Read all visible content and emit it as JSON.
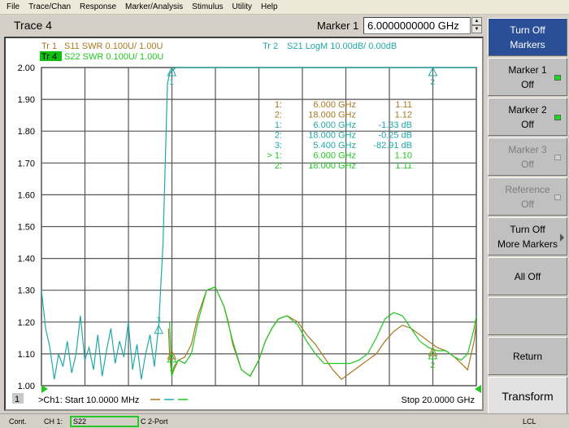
{
  "menu": [
    "File",
    "Trace/Chan",
    "Response",
    "Marker/Analysis",
    "Stimulus",
    "Utility",
    "Help"
  ],
  "toolbar": {
    "active_trace": "Trace 4",
    "marker_label": "Marker 1",
    "marker_value": "6.0000000000 GHz"
  },
  "traces": {
    "tr1": {
      "id": "Tr 1",
      "desc": "S11 SWR 0.100U/  1.00U",
      "color": "#a87820"
    },
    "tr2": {
      "id": "Tr 2",
      "desc": "S21 LogM 10.00dB/  0.00dB",
      "color": "#20a8a8"
    },
    "tr4": {
      "id": "Tr 4",
      "desc": "S22 SWR 0.100U/  1.00U",
      "color": "#20c820"
    }
  },
  "marker_table": [
    {
      "trace": "tr1",
      "num": "1:",
      "freq": "6.000 GHz",
      "value": "1.11"
    },
    {
      "trace": "tr1",
      "num": "2:",
      "freq": "18.000 GHz",
      "value": "1.12"
    },
    {
      "trace": "tr2",
      "num": "1:",
      "freq": "6.000 GHz",
      "value": "-1.33 dB"
    },
    {
      "trace": "tr2",
      "num": "2:",
      "freq": "18.000 GHz",
      "value": "-0.25 dB"
    },
    {
      "trace": "tr2",
      "num": "3:",
      "freq": "5.400 GHz",
      "value": "-82.91 dB"
    },
    {
      "trace": "tr4",
      "num": "> 1:",
      "freq": "6.000 GHz",
      "value": "1.10"
    },
    {
      "trace": "tr4",
      "num": "2:",
      "freq": "18.000 GHz",
      "value": "1.11"
    }
  ],
  "footer": {
    "channel_num": "1",
    "start": ">Ch1: Start  10.0000 MHz",
    "stop": "Stop  20.0000 GHz"
  },
  "softkeys": [
    {
      "line1": "Turn Off",
      "line2": "Markers",
      "style": "blue"
    },
    {
      "line1": "Marker 1",
      "line2": "Off",
      "led": "on"
    },
    {
      "line1": "Marker 2",
      "line2": "Off",
      "led": "on"
    },
    {
      "line1": "Marker 3",
      "line2": "Off",
      "led": "off",
      "disabled": true
    },
    {
      "line1": "Reference",
      "line2": "Off",
      "led": "off",
      "disabled": true
    },
    {
      "line1": "Turn Off",
      "line2": "More Markers",
      "submenu": true
    },
    {
      "line1": "All Off",
      "line2": ""
    },
    {
      "line1": "",
      "line2": ""
    },
    {
      "line1": "Return",
      "line2": ""
    },
    {
      "line1": "Transform",
      "line2": "",
      "style": "transform"
    }
  ],
  "status": {
    "mode": "Cont.",
    "channel": "CH 1:",
    "param": "S22",
    "cal": "C  2-Port",
    "remote": "LCL"
  },
  "chart_data": {
    "type": "line",
    "title": "",
    "xlabel": "",
    "ylabel": "",
    "x_range_ghz": [
      0.01,
      20.0
    ],
    "ylim": [
      1.0,
      2.0
    ],
    "y_ticks": [
      "2.00",
      "1.90",
      "1.80",
      "1.70",
      "1.60",
      "1.50",
      "1.40",
      "1.30",
      "1.20",
      "1.10",
      "1.00"
    ],
    "grid": true,
    "x_divisions": 10,
    "series": [
      {
        "name": "Tr 1 S11 SWR",
        "color": "#a87820",
        "x": [
          5.85,
          5.9,
          6.0,
          6.1,
          6.3,
          6.6,
          6.9,
          7.2,
          7.6,
          8.0,
          8.4,
          8.6,
          8.8,
          9.2,
          9.6,
          10.0,
          10.3,
          10.6,
          10.9,
          11.3,
          11.8,
          12.2,
          12.6,
          13.0,
          13.4,
          13.8,
          14.2,
          14.6,
          15.0,
          15.4,
          15.8,
          16.2,
          16.6,
          17.0,
          17.4,
          17.8,
          18.2,
          18.6,
          19.0,
          19.3,
          19.6,
          19.9,
          20.0
        ],
        "y": [
          1.18,
          1.1,
          1.03,
          1.05,
          1.08,
          1.09,
          1.13,
          1.22,
          1.3,
          1.31,
          1.25,
          1.2,
          1.13,
          1.05,
          1.03,
          1.08,
          1.14,
          1.18,
          1.21,
          1.22,
          1.2,
          1.16,
          1.13,
          1.09,
          1.05,
          1.02,
          1.04,
          1.06,
          1.08,
          1.1,
          1.14,
          1.17,
          1.19,
          1.18,
          1.16,
          1.14,
          1.12,
          1.11,
          1.09,
          1.07,
          1.05,
          1.14,
          1.2
        ]
      },
      {
        "name": "Tr 2 S21 LogM",
        "color": "#20a8a8",
        "note": "plotted on LogM scale; shown as passband near top reference (0 dB) above 6 GHz and noisy stopband below",
        "x": [
          0.01,
          0.2,
          0.4,
          0.6,
          0.8,
          1.0,
          1.2,
          1.4,
          1.6,
          1.8,
          2.0,
          2.2,
          2.4,
          2.6,
          2.8,
          3.0,
          3.2,
          3.4,
          3.6,
          3.8,
          4.0,
          4.2,
          4.4,
          4.6,
          4.8,
          5.0,
          5.2,
          5.4,
          5.6,
          5.8,
          5.9,
          6.0,
          6.2,
          6.5,
          7.0,
          8.0,
          10.0,
          12.0,
          14.0,
          16.0,
          18.0,
          20.0
        ],
        "y": [
          1.3,
          1.18,
          1.12,
          1.02,
          1.1,
          1.06,
          1.14,
          1.04,
          1.1,
          1.22,
          1.08,
          1.12,
          1.05,
          1.16,
          1.03,
          1.11,
          1.18,
          1.07,
          1.14,
          1.09,
          1.2,
          1.05,
          1.13,
          1.02,
          1.1,
          1.16,
          1.06,
          1.19,
          1.45,
          1.95,
          1.98,
          1.99,
          2.0,
          2.0,
          2.0,
          2.0,
          2.0,
          2.0,
          2.0,
          2.0,
          2.0,
          2.0
        ]
      },
      {
        "name": "Tr 4 S22 SWR",
        "color": "#20c820",
        "x": [
          5.9,
          6.0,
          6.1,
          6.3,
          6.6,
          6.9,
          7.2,
          7.6,
          8.0,
          8.4,
          8.8,
          9.2,
          9.6,
          10.0,
          10.3,
          10.6,
          10.9,
          11.3,
          11.8,
          12.2,
          12.6,
          13.0,
          13.4,
          13.8,
          14.2,
          14.6,
          15.0,
          15.4,
          15.8,
          16.2,
          16.6,
          17.0,
          17.4,
          17.8,
          18.2,
          18.6,
          19.0,
          19.3,
          19.6,
          19.9,
          20.0
        ],
        "y": [
          1.2,
          1.03,
          1.06,
          1.08,
          1.07,
          1.1,
          1.2,
          1.3,
          1.31,
          1.25,
          1.14,
          1.05,
          1.03,
          1.08,
          1.14,
          1.18,
          1.21,
          1.22,
          1.19,
          1.14,
          1.1,
          1.07,
          1.07,
          1.07,
          1.07,
          1.08,
          1.1,
          1.15,
          1.21,
          1.23,
          1.22,
          1.18,
          1.14,
          1.12,
          1.11,
          1.11,
          1.09,
          1.08,
          1.1,
          1.18,
          1.22
        ]
      }
    ],
    "markers": [
      {
        "trace": "Tr 2",
        "label": "1",
        "x": 6.0,
        "y": 2.0
      },
      {
        "trace": "Tr 2",
        "label": "2",
        "x": 18.0,
        "y": 2.0
      },
      {
        "trace": "Tr 2",
        "label": "3",
        "x": 5.4,
        "y": 1.19
      },
      {
        "trace": "Tr 4",
        "label": "1",
        "x": 6.0,
        "y": 1.1
      },
      {
        "trace": "Tr 4",
        "label": "2",
        "x": 18.0,
        "y": 1.11
      },
      {
        "trace": "Tr 1",
        "label": "1",
        "x": 6.0,
        "y": 1.11
      },
      {
        "trace": "Tr 1",
        "label": "2",
        "x": 18.0,
        "y": 1.12
      }
    ]
  }
}
